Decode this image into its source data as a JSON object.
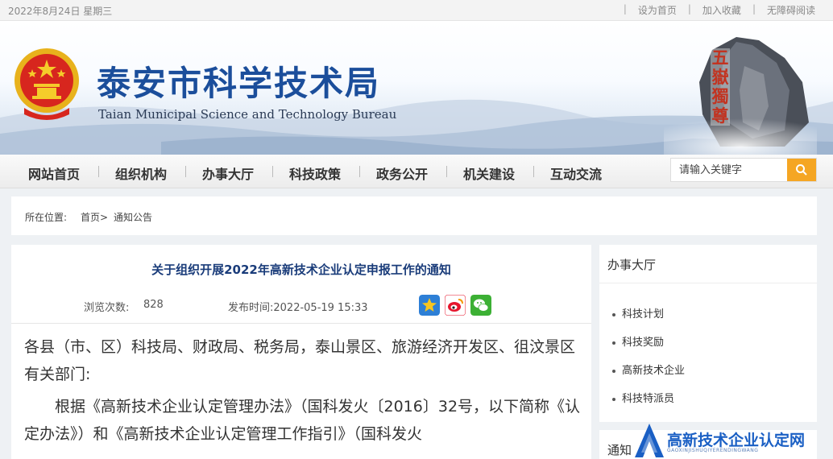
{
  "topbar": {
    "date": "2022年8月24日 星期三",
    "links": [
      "设为首页",
      "加入收藏",
      "无障碍阅读"
    ]
  },
  "header": {
    "title_cn": "泰安市科学技术局",
    "title_en": "Taian Municipal Science and Technology Bureau",
    "rock_text": "五嶽獨尊"
  },
  "nav": {
    "items": [
      "网站首页",
      "组织机构",
      "办事大厅",
      "科技政策",
      "政务公开",
      "机关建设",
      "互动交流"
    ],
    "search_placeholder": "请输入关键字"
  },
  "breadcrumb": {
    "label": "所在位置:",
    "home": "首页>",
    "current": "通知公告"
  },
  "article": {
    "title": "关于组织开展2022年高新技术企业认定申报工作的通知",
    "views_label": "浏览次数:",
    "views": "828",
    "publish_label": "发布时间:2022-05-19 15:33",
    "para1": "各县（市、区）科技局、财政局、税务局，泰山景区、旅游经济开发区、徂汶景区有关部门:",
    "para2": "根据《高新技术企业认定管理办法》（国科发火〔2016〕32号，以下简称《认定办法》）和《高新技术企业认定管理工作指引》（国科发火"
  },
  "sidebar": {
    "heading": "办事大厅",
    "items": [
      "科技计划",
      "科技奖励",
      "高新技术企业",
      "科技特派员"
    ],
    "heading2": "通知"
  },
  "watermark": {
    "text": "高新技术企业认定网",
    "sub": "GAOXINJISHUQIYERENDINGWANG"
  },
  "colors": {
    "brand_blue": "#1b4e9b",
    "accent_orange": "#f5a623",
    "title_blue": "#1a3c7a"
  }
}
